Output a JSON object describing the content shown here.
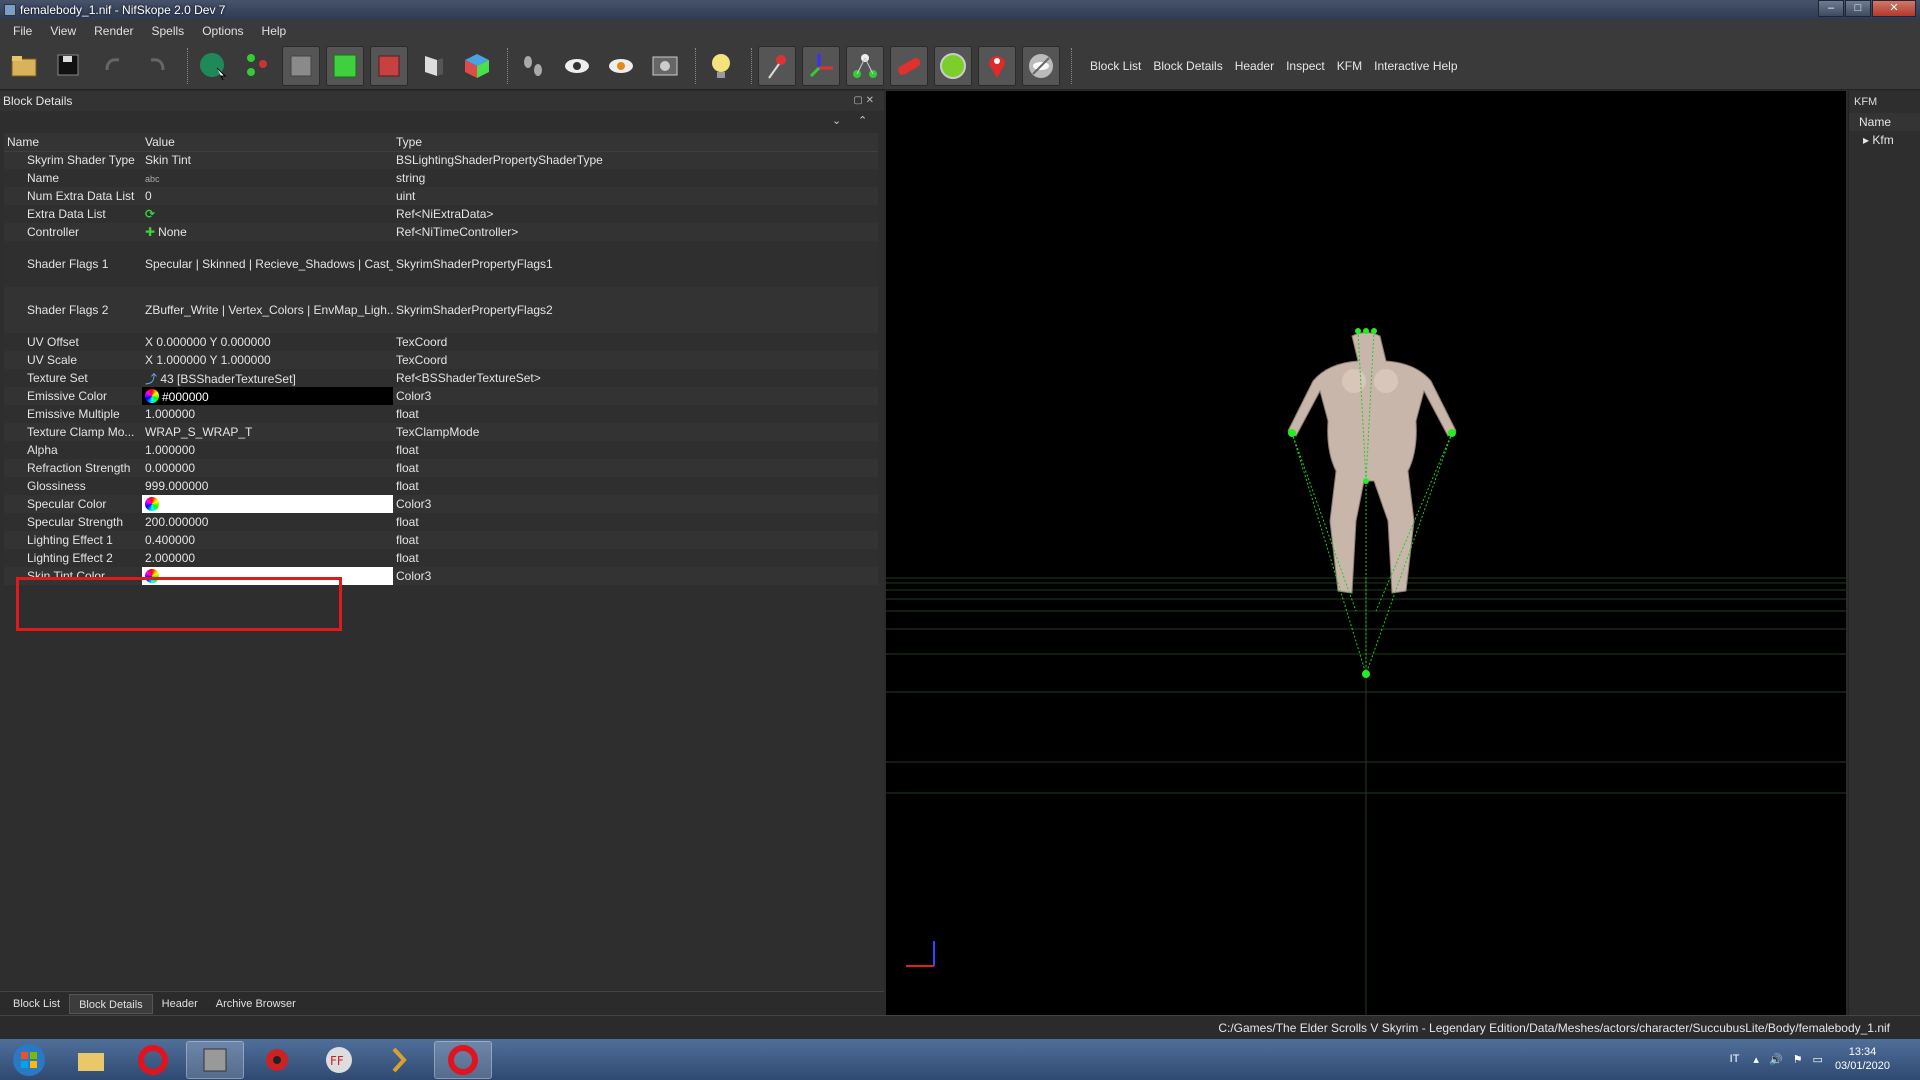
{
  "window": {
    "title": "femalebody_1.nif - NifSkope 2.0 Dev 7"
  },
  "menu": [
    "File",
    "View",
    "Render",
    "Spells",
    "Options",
    "Help"
  ],
  "toolbar": {
    "links": [
      "Block List",
      "Block Details",
      "Header",
      "Inspect",
      "KFM",
      "Interactive Help"
    ]
  },
  "block_details": {
    "title": "Block Details",
    "columns": [
      "Name",
      "Value",
      "Type"
    ],
    "rows": [
      {
        "name": "Skyrim Shader Type",
        "value": "Skin Tint",
        "type": "BSLightingShaderPropertyShaderType"
      },
      {
        "name": "Name",
        "value": "",
        "type": "string"
      },
      {
        "name": "Num Extra Data List",
        "value": "0",
        "type": "uint"
      },
      {
        "name": "Extra Data List",
        "value": "",
        "type": "Ref<NiExtraData>"
      },
      {
        "name": "Controller",
        "value": "None",
        "type": "Ref<NiTimeController>"
      },
      {
        "name": "Shader Flags 1",
        "value": "Specular | Skinned | Recieve_Shadows | Cast_...",
        "type": "SkyrimShaderPropertyFlags1"
      },
      {
        "name": "Shader Flags 2",
        "value": "ZBuffer_Write | Vertex_Colors | EnvMap_Ligh...",
        "type": "SkyrimShaderPropertyFlags2"
      },
      {
        "name": "UV Offset",
        "value": "X 0.000000 Y 0.000000",
        "type": "TexCoord"
      },
      {
        "name": "UV Scale",
        "value": "X 1.000000 Y 1.000000",
        "type": "TexCoord"
      },
      {
        "name": "Texture Set",
        "value": "43 [BSShaderTextureSet]",
        "type": "Ref<BSShaderTextureSet>"
      },
      {
        "name": "Emissive Color",
        "value": "#000000",
        "type": "Color3"
      },
      {
        "name": "Emissive Multiple",
        "value": "1.000000",
        "type": "float"
      },
      {
        "name": "Texture Clamp Mo...",
        "value": "WRAP_S_WRAP_T",
        "type": "TexClampMode"
      },
      {
        "name": "Alpha",
        "value": "1.000000",
        "type": "float"
      },
      {
        "name": "Refraction Strength",
        "value": "0.000000",
        "type": "float"
      },
      {
        "name": "Glossiness",
        "value": "999.000000",
        "type": "float"
      },
      {
        "name": "Specular Color",
        "value": "",
        "type": "Color3"
      },
      {
        "name": "Specular Strength",
        "value": "200.000000",
        "type": "float"
      },
      {
        "name": "Lighting Effect 1",
        "value": "0.400000",
        "type": "float"
      },
      {
        "name": "Lighting Effect 2",
        "value": "2.000000",
        "type": "float"
      },
      {
        "name": "Skin Tint Color",
        "value": "",
        "type": "Color3"
      }
    ]
  },
  "kfm": {
    "title": "KFM",
    "column": "Name",
    "item": "Kfm"
  },
  "bottom_tabs": [
    "Block List",
    "Block Details",
    "Header",
    "Archive Browser"
  ],
  "status": {
    "path": "C:/Games/The Elder Scrolls V Skyrim - Legendary Edition/Data/Meshes/actors/character/SuccubusLite/Body/femalebody_1.nif"
  },
  "taskbar": {
    "lang": "IT",
    "time": "13:34",
    "date": "03/01/2020",
    "ff_label": "FF"
  },
  "colors": {
    "highlight": "#e01a1a",
    "skeleton": "#22cc22",
    "body": "#c9b6ab"
  }
}
